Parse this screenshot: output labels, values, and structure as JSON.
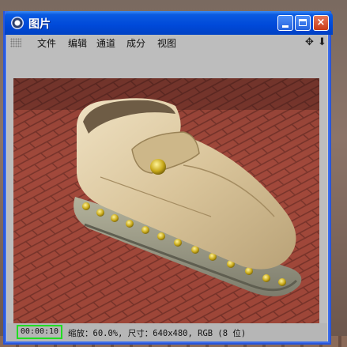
{
  "window": {
    "title": "图片",
    "controls": {
      "minimize": "minimize",
      "maximize": "maximize",
      "close": "×"
    }
  },
  "menu": {
    "items": [
      "文件",
      "编辑",
      "通道",
      "成分",
      "视图"
    ]
  },
  "toolbar_icons": [
    "move-icon",
    "arrow-down-icon"
  ],
  "status": {
    "timecode": "00:00:10",
    "info": "缩放：60.0%, 尺寸：640x480, RGB (8 位)"
  },
  "colors": {
    "titlebar": "#0049d9",
    "close_button": "#c83a16",
    "timecode_border": "#22dd22",
    "client_bg": "#bdbdbd"
  },
  "image": {
    "subject": "rendered leather shoe with studded sole on brick floor"
  }
}
